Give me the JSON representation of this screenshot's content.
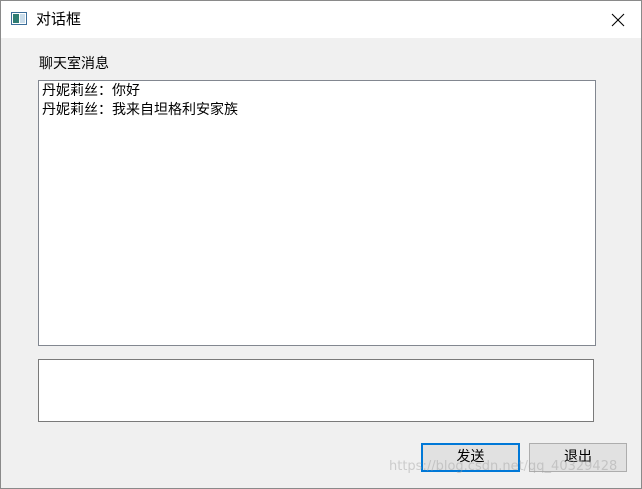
{
  "window": {
    "title": "对话框",
    "icon": "dialog-app-icon",
    "close_icon": "close-icon"
  },
  "chat": {
    "label": "聊天室消息",
    "messages": [
      "丹妮莉丝：你好",
      "丹妮莉丝：我来自坦格利安家族"
    ]
  },
  "input": {
    "value": ""
  },
  "buttons": {
    "send_label": "发送",
    "exit_label": "退出"
  },
  "watermark": {
    "text": "https://blog.csdn.net/qq_40329428"
  },
  "colors": {
    "focus_accent": "#0078d7",
    "dialog_background": "#f0f0f0",
    "button_face": "#e1e1e1"
  }
}
